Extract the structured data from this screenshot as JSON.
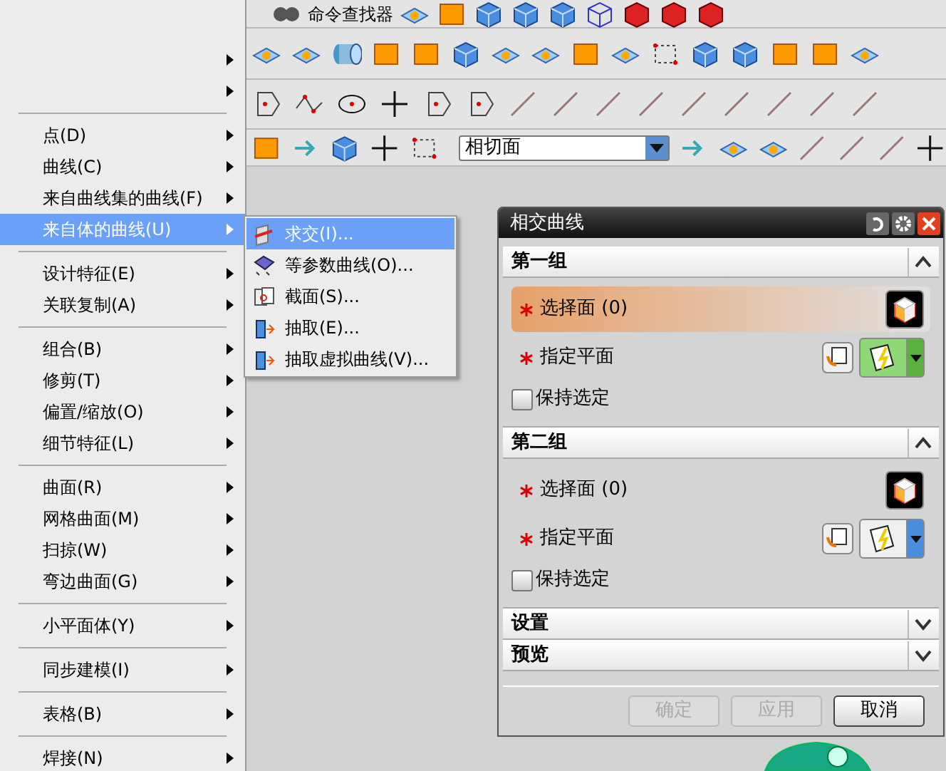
{
  "toolbar": {
    "command_finder": "命令查找器",
    "filter_dropdown": "相切面"
  },
  "menu": {
    "items": [
      {
        "kind": "item",
        "submenu": true,
        "selected": false
      },
      {
        "kind": "item",
        "submenu": true,
        "selected": false
      },
      {
        "kind": "separator"
      },
      {
        "kind": "item",
        "label": "点(D)",
        "submenu": true,
        "selected": false
      },
      {
        "kind": "item",
        "label": "曲线(C)",
        "submenu": true,
        "selected": false
      },
      {
        "kind": "item",
        "label": "来自曲线集的曲线(F)",
        "submenu": true,
        "selected": false
      },
      {
        "kind": "item",
        "label": "来自体的曲线(U)",
        "submenu": true,
        "selected": true
      },
      {
        "kind": "separator"
      },
      {
        "kind": "item",
        "label": "设计特征(E)",
        "submenu": true,
        "selected": false
      },
      {
        "kind": "item",
        "label": "关联复制(A)",
        "submenu": true,
        "selected": false
      },
      {
        "kind": "separator"
      },
      {
        "kind": "item",
        "label": "组合(B)",
        "submenu": true,
        "selected": false
      },
      {
        "kind": "item",
        "label": "修剪(T)",
        "submenu": true,
        "selected": false
      },
      {
        "kind": "item",
        "label": "偏置/缩放(O)",
        "submenu": true,
        "selected": false
      },
      {
        "kind": "item",
        "label": "细节特征(L)",
        "submenu": true,
        "selected": false
      },
      {
        "kind": "separator"
      },
      {
        "kind": "item",
        "label": "曲面(R)",
        "submenu": true,
        "selected": false
      },
      {
        "kind": "item",
        "label": "网格曲面(M)",
        "submenu": true,
        "selected": false
      },
      {
        "kind": "item",
        "label": "扫掠(W)",
        "submenu": true,
        "selected": false
      },
      {
        "kind": "item",
        "label": "弯边曲面(G)",
        "submenu": true,
        "selected": false
      },
      {
        "kind": "separator"
      },
      {
        "kind": "item",
        "label": "小平面体(Y)",
        "submenu": true,
        "selected": false
      },
      {
        "kind": "separator"
      },
      {
        "kind": "item",
        "label": "同步建模(I)",
        "submenu": true,
        "selected": false
      },
      {
        "kind": "separator"
      },
      {
        "kind": "item",
        "label": "表格(B)",
        "submenu": true,
        "selected": false
      },
      {
        "kind": "separator"
      },
      {
        "kind": "item",
        "label": "焊接(N)",
        "submenu": true,
        "selected": false
      }
    ]
  },
  "submenu": {
    "items": [
      {
        "label": "求交(I)...",
        "selected": true
      },
      {
        "label": "等参数曲线(O)...",
        "selected": false
      },
      {
        "label": "截面(S)...",
        "selected": false
      },
      {
        "label": "抽取(E)...",
        "selected": false
      },
      {
        "label": "抽取虚拟曲线(V)...",
        "selected": false
      }
    ]
  },
  "dialog": {
    "title": "相交曲线",
    "sections": [
      {
        "title": "第一组",
        "expanded": true,
        "select_face": {
          "label": "选择面 (0)",
          "selected": true
        },
        "specify_plane": {
          "label": "指定平面",
          "selected": true
        },
        "keep_selected": {
          "label": "保持选定",
          "checked": false
        }
      },
      {
        "title": "第二组",
        "expanded": true,
        "select_face": {
          "label": "选择面 (0)",
          "selected": false
        },
        "specify_plane": {
          "label": "指定平面",
          "selected": false
        },
        "keep_selected": {
          "label": "保持选定",
          "checked": false
        }
      },
      {
        "title": "设置",
        "expanded": false
      },
      {
        "title": "预览",
        "expanded": false
      }
    ],
    "buttons": [
      {
        "label": "确定",
        "disabled": true
      },
      {
        "label": "应用",
        "disabled": true
      },
      {
        "label": "取消",
        "disabled": false
      }
    ]
  }
}
